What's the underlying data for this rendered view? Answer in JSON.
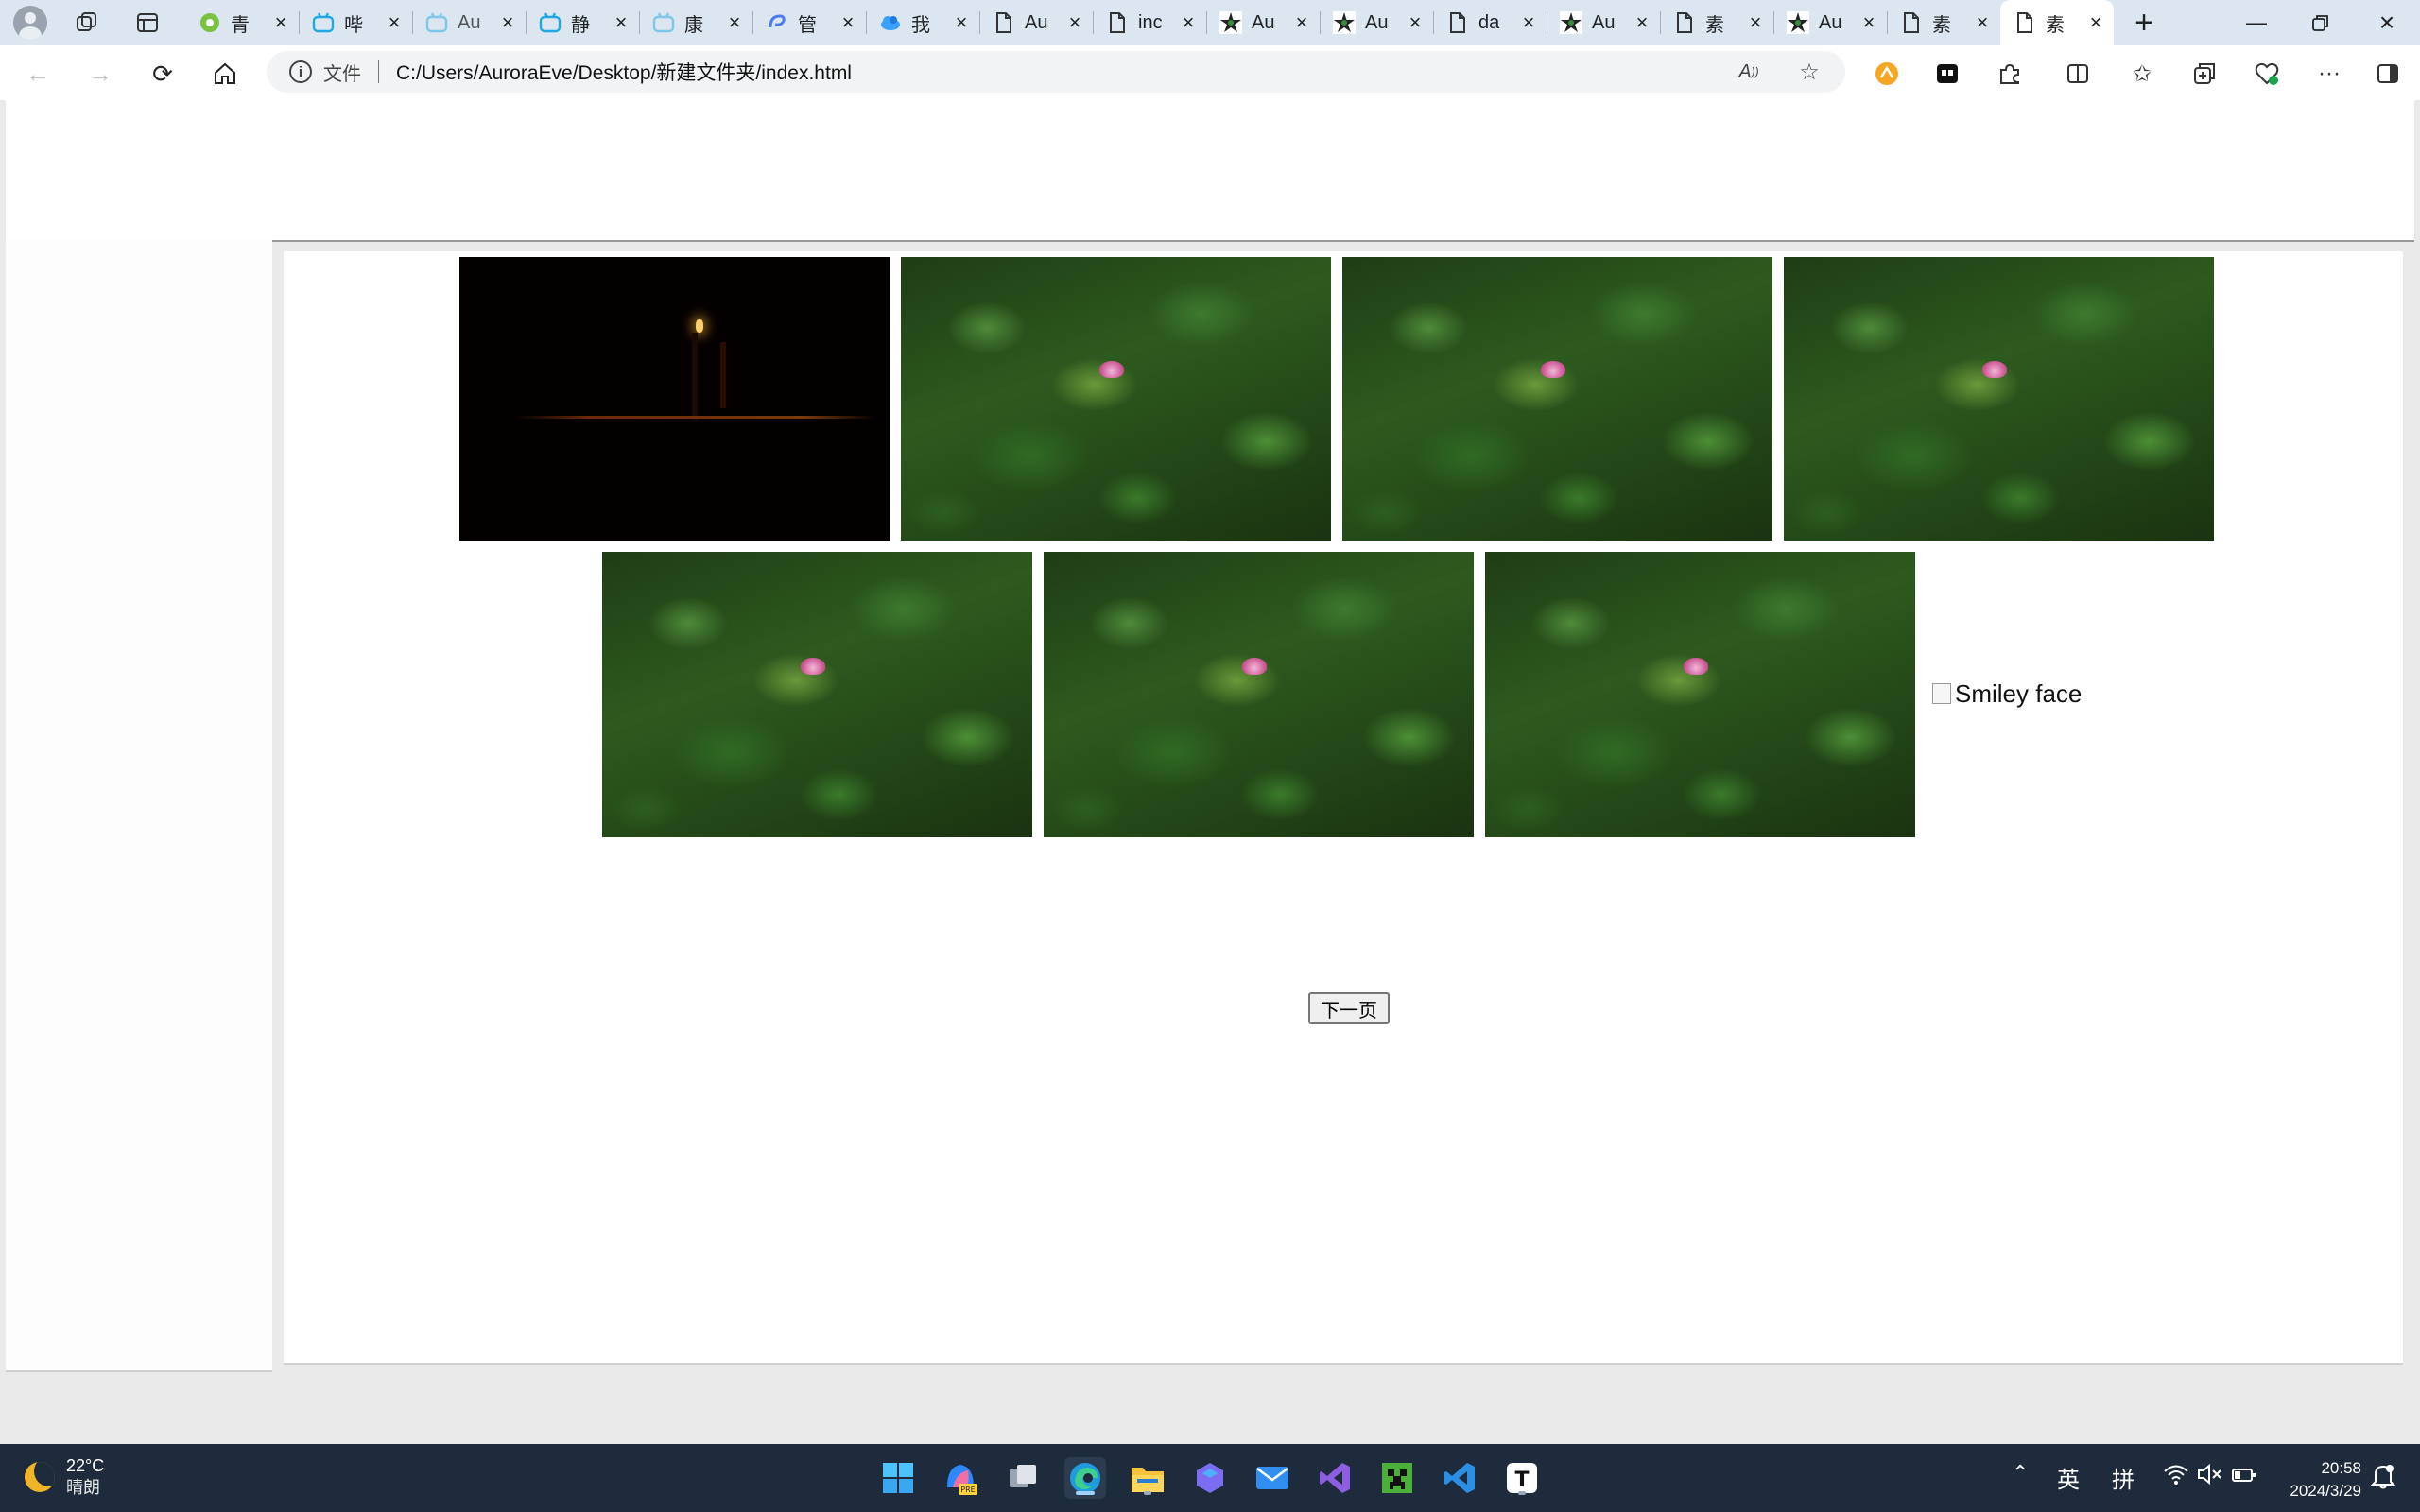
{
  "browser": {
    "tabs": [
      {
        "label": "青",
        "icon": "green-flower-icon"
      },
      {
        "label": "哔",
        "icon": "bilibili-icon"
      },
      {
        "label": "Au",
        "icon": "bilibili-icon"
      },
      {
        "label": "静",
        "icon": "bilibili-icon"
      },
      {
        "label": "康",
        "icon": "bilibili-icon"
      },
      {
        "label": "管",
        "icon": "blue-swirl-icon"
      },
      {
        "label": "我",
        "icon": "blue-cloud-icon"
      },
      {
        "label": "Au",
        "icon": "page-icon"
      },
      {
        "label": "inc",
        "icon": "page-icon"
      },
      {
        "label": "Au",
        "icon": "star-logo-icon"
      },
      {
        "label": "Au",
        "icon": "star-logo-icon"
      },
      {
        "label": "da",
        "icon": "page-icon"
      },
      {
        "label": "Au",
        "icon": "star-logo-icon"
      },
      {
        "label": "素",
        "icon": "page-icon"
      },
      {
        "label": "Au",
        "icon": "star-logo-icon"
      },
      {
        "label": "素",
        "icon": "page-icon"
      },
      {
        "label": "素",
        "icon": "page-icon",
        "active": true
      }
    ],
    "address": {
      "scheme_label": "文件",
      "url": "C:/Users/AuroraEve/Desktop/新建文件夹/index.html"
    }
  },
  "page": {
    "images": [
      {
        "alt": "night-scene"
      },
      {
        "alt": "lotus"
      },
      {
        "alt": "lotus"
      },
      {
        "alt": "lotus"
      },
      {
        "alt": "lotus"
      },
      {
        "alt": "lotus"
      },
      {
        "alt": "lotus"
      }
    ],
    "broken_image_alt": "Smiley face",
    "next_button_label": "下一页"
  },
  "taskbar": {
    "weather": {
      "temp": "22°C",
      "condition": "晴朗"
    },
    "ime_lang": "英",
    "ime_mode": "拼",
    "time": "20:58",
    "date": "2024/3/29"
  },
  "colors": {
    "titlebar": "#dbe6f1",
    "taskbar": "#1e2b3c",
    "accent": "#0078d4"
  }
}
